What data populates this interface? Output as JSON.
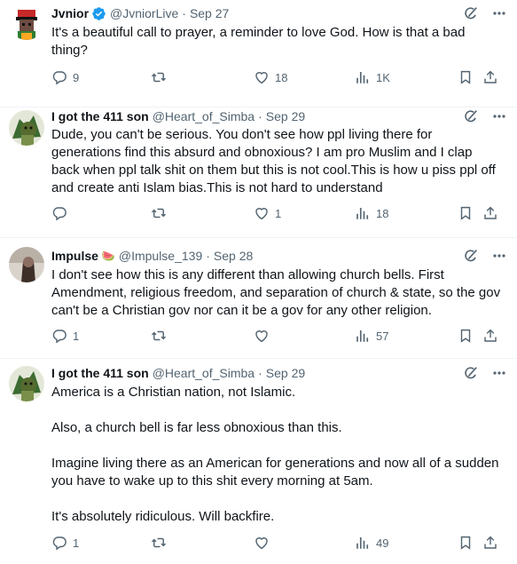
{
  "tweets": [
    {
      "name": "Jvnior",
      "verified": true,
      "emoji": "",
      "handle": "@JvniorLive",
      "sep": "·",
      "date": "Sep 27",
      "paragraphs": [
        "It's a beautiful call to prayer, a reminder to love God. How is that a bad thing?"
      ],
      "replies": "9",
      "retweets": "",
      "likes": "18",
      "views": "1K"
    },
    {
      "name": "I got the 411 son",
      "verified": false,
      "emoji": "",
      "handle": "@Heart_of_Simba",
      "sep": "·",
      "date": "Sep 29",
      "paragraphs": [
        "Dude, you can't be serious. You don't see how ppl living there for generations find this absurd and obnoxious? I am pro Muslim and I clap back when ppl talk shit on them but this is not cool.This is how u piss ppl off and create anti Islam bias.This is not hard to understand"
      ],
      "replies": "",
      "retweets": "",
      "likes": "1",
      "views": "18"
    },
    {
      "name": "Impulse",
      "verified": false,
      "emoji": "🍉",
      "handle": "@Impulse_139",
      "sep": "·",
      "date": "Sep 28",
      "paragraphs": [
        "I don't see how this is any different than allowing church bells. First Amendment, religious freedom, and separation of church & state, so the gov can't be a Christian gov nor can it be a gov for any other religion."
      ],
      "replies": "1",
      "retweets": "",
      "likes": "",
      "views": "57"
    },
    {
      "name": "I got the 411 son",
      "verified": false,
      "emoji": "",
      "handle": "@Heart_of_Simba",
      "sep": "·",
      "date": "Sep 29",
      "paragraphs": [
        "America is a Christian nation, not Islamic.",
        "Also, a church bell is far less obnoxious than this.",
        "Imagine living there as an American for generations and now all of a sudden you have to wake up to this shit every morning at 5am.",
        "It's absolutely ridiculous. Will backfire."
      ],
      "replies": "1",
      "retweets": "",
      "likes": "",
      "views": "49"
    }
  ],
  "icons": {
    "header": [
      "grok-icon",
      "more-icon"
    ],
    "actions": [
      "reply-icon",
      "retweet-icon",
      "like-icon",
      "views-icon",
      "bookmark-icon",
      "share-icon"
    ]
  },
  "colors": {
    "text": "#0f1419",
    "secondary": "#536471",
    "verified": "#1d9bf0",
    "divider": "#eff3f4"
  }
}
